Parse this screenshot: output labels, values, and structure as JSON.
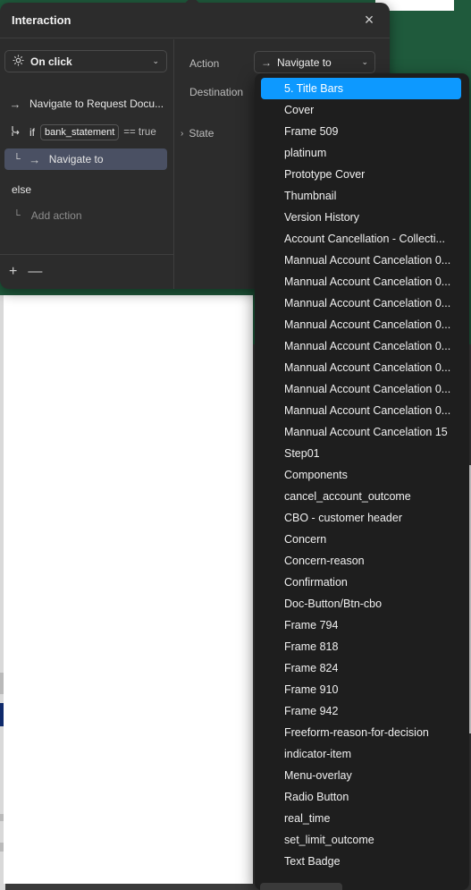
{
  "panel": {
    "title": "Interaction",
    "close_glyph": "×"
  },
  "trigger": {
    "label": "On click",
    "icon": "tap-icon"
  },
  "actions": {
    "navigate_first": "Navigate to Request Docu...",
    "condition_keyword": "if",
    "condition_variable": "bank_statement",
    "condition_operator": "== true",
    "navigate_nested": "Navigate to",
    "else_label": "else",
    "add_action": "Add action"
  },
  "footer": {
    "add_glyph": "+",
    "remove_glyph": "—"
  },
  "right": {
    "action_label": "Action",
    "action_value": "Navigate to",
    "destination_label": "Destination",
    "state_label": "State"
  },
  "destination_options": {
    "selected": "5. Title Bars",
    "items": [
      "5. Title Bars",
      "Cover",
      "Frame 509",
      "platinum",
      "Prototype Cover",
      "Thumbnail",
      "Version History",
      "Account Cancellation - Collecti...",
      "Mannual Account Cancelation 0...",
      "Mannual Account Cancelation 0...",
      "Mannual Account Cancelation 0...",
      "Mannual Account Cancelation 0...",
      "Mannual Account Cancelation 0...",
      "Mannual Account Cancelation 0...",
      "Mannual Account Cancelation 0...",
      "Mannual Account Cancelation 0...",
      "Mannual Account Cancelation 15",
      "Step01",
      "Components",
      "cancel_account_outcome",
      "CBO - customer header",
      "Concern",
      "Concern-reason",
      "Confirmation",
      "Doc-Button/Btn-cbo",
      "Frame 794",
      "Frame 818",
      "Frame 824",
      "Frame 910",
      "Frame 942",
      "Freeform-reason-for-decision",
      "indicator-item",
      "Menu-overlay",
      "Radio Button",
      "real_time",
      "set_limit_outcome",
      "Text Badge"
    ]
  },
  "colors": {
    "panel_bg": "#2c2c2c",
    "dropdown_bg": "#1e1e1e",
    "selected_accent": "#0d99ff",
    "nested_row_highlight": "#4a5063",
    "canvas_green": "#1f5a3c"
  }
}
